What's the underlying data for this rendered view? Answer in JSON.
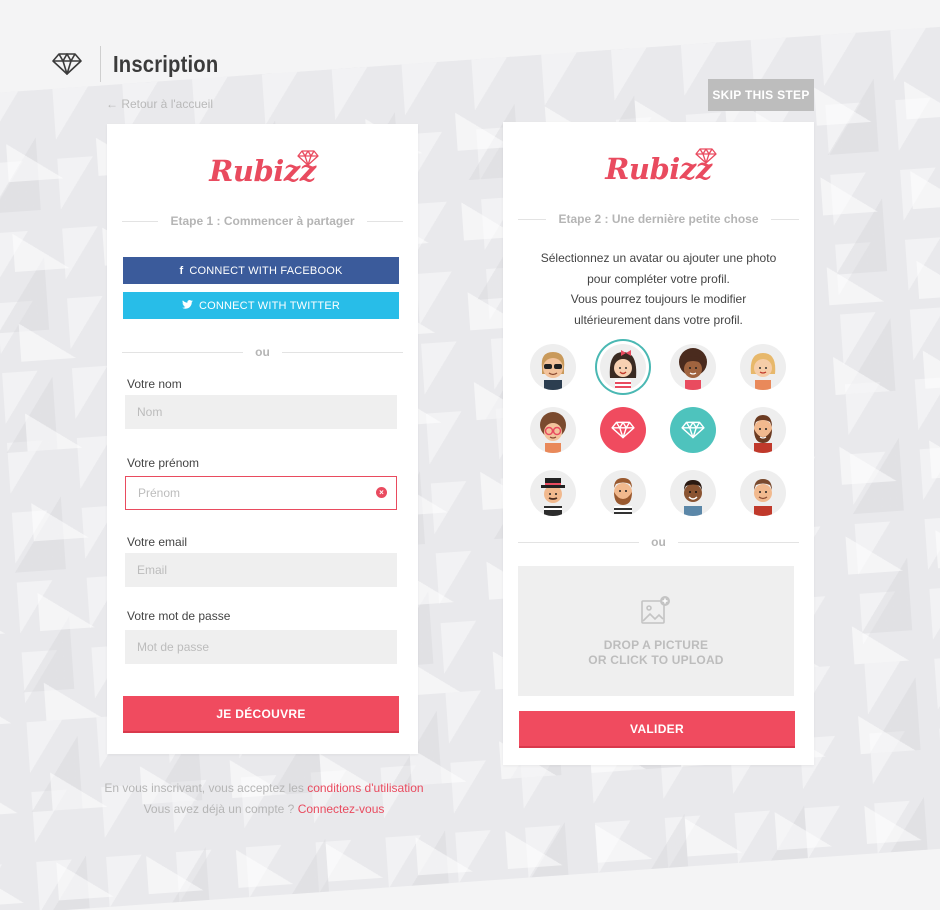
{
  "header": {
    "title": "Inscription",
    "back_link": "← Retour à l'accueil",
    "logo_icon": "diamond-icon"
  },
  "skip_label": "SKIP THIS STEP",
  "brand": {
    "name": "Rubizz",
    "color": "#e94b5f"
  },
  "step1": {
    "title": "Etape 1 : Commencer à partager",
    "facebook_label": "CONNECT WITH FACEBOOK",
    "twitter_label": "CONNECT WITH TWITTER",
    "or": "ou",
    "fields": {
      "nom": {
        "label": "Votre nom",
        "placeholder": "Nom"
      },
      "prenom": {
        "label": "Votre prénom",
        "placeholder": "Prénom"
      },
      "email": {
        "label": "Votre email",
        "placeholder": "Email"
      },
      "password": {
        "label": "Votre mot de passe",
        "placeholder": "Mot de passe"
      }
    },
    "submit_label": "JE DÉCOUVRE"
  },
  "footer": {
    "line1_text": "En vous inscrivant, vous acceptez les ",
    "line1_link": "conditions d'utilisation",
    "line2_text": "Vous avez déjà un compte ? ",
    "line2_link": "Connectez-vous"
  },
  "step2": {
    "title": "Etape 2 : Une dernière petite chose",
    "intro_lines": [
      "Sélectionnez un avatar ou ajouter une photo",
      "pour compléter votre profil.",
      "Vous pourrez toujours le modifier",
      "ultérieurement dans votre profil."
    ],
    "avatars": [
      "avatar-woman-sunglasses",
      "avatar-girl-red-bow",
      "avatar-woman-curly",
      "avatar-woman-blonde",
      "avatar-woman-glasses",
      "avatar-ruby-red",
      "avatar-ruby-teal",
      "avatar-man-beard",
      "avatar-man-hat",
      "avatar-man-beard-striped",
      "avatar-man-smiling",
      "avatar-man-red-shirt"
    ],
    "selected_avatar_index": 1,
    "or": "ou",
    "drop_line1": "DROP A PICTURE",
    "drop_line2": "OR CLICK TO UPLOAD",
    "submit_label": "VALIDER"
  },
  "colors": {
    "accent": "#f04b5f",
    "facebook": "#3b5b9b",
    "twitter": "#28bde8",
    "teal": "#4ec3bd"
  }
}
